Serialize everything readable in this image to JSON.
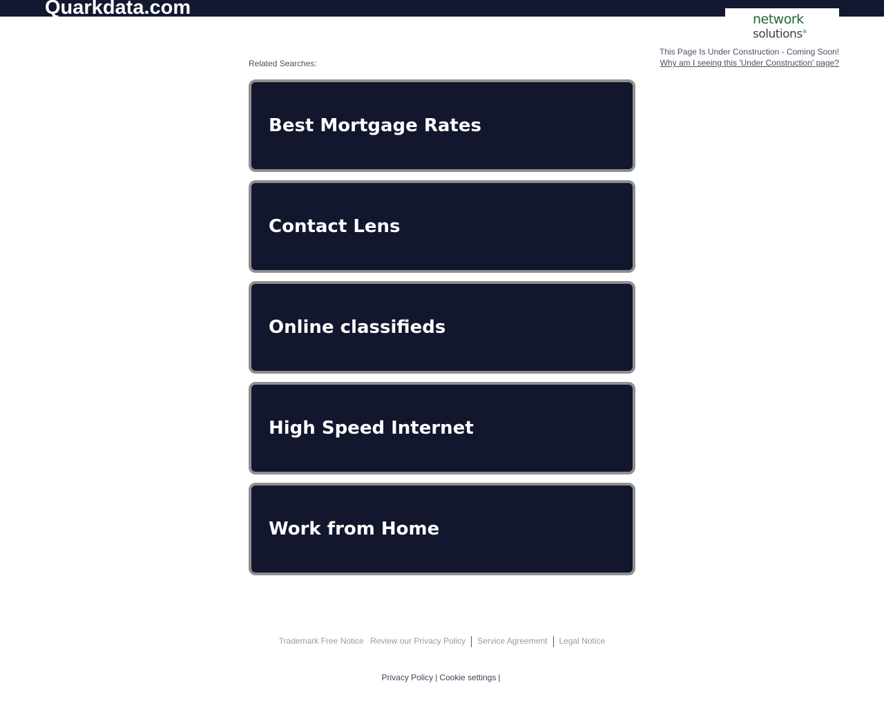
{
  "header": {
    "domain": "Quarkdata.com"
  },
  "logo": {
    "line1": "network",
    "line2": "solutions",
    "reg": "®"
  },
  "notice": {
    "status": "This Page Is Under Construction - Coming Soon!",
    "why_link": "Why am I seeing this 'Under Construction' page?"
  },
  "related": {
    "label": "Related Searches:",
    "items": [
      {
        "label": "Best Mortgage Rates"
      },
      {
        "label": "Contact Lens"
      },
      {
        "label": "Online classifieds"
      },
      {
        "label": "High Speed Internet"
      },
      {
        "label": "Work from Home"
      }
    ]
  },
  "footer": {
    "trademark": "Trademark Free Notice",
    "privacy_review": "Review our Privacy Policy",
    "service": "Service Agreement",
    "legal": "Legal Notice",
    "privacy_policy": "Privacy Policy",
    "cookie_settings": "Cookie settings",
    "pipe": "|"
  },
  "colors": {
    "header_bg": "#121830",
    "card_bg": "#12172d",
    "card_border": "#8f8f93",
    "logo_green": "#1f6b2e"
  }
}
